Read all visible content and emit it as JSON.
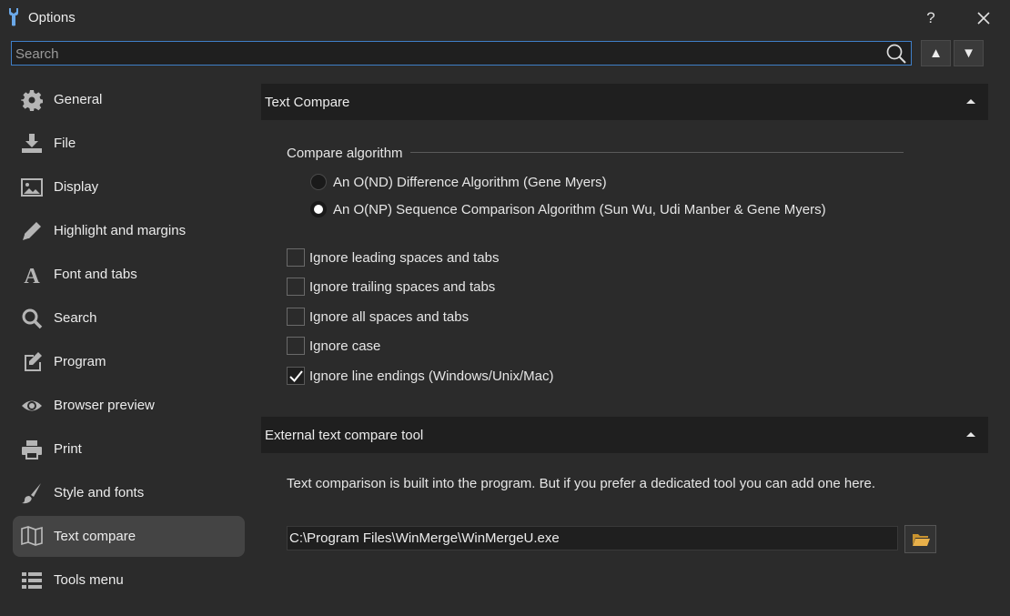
{
  "window": {
    "title": "Options",
    "help_label": "?"
  },
  "search": {
    "placeholder": "Search",
    "up_label": "▲",
    "down_label": "▼"
  },
  "sidebar": {
    "items": [
      {
        "label": "General",
        "icon": "gear-icon"
      },
      {
        "label": "File",
        "icon": "download-icon"
      },
      {
        "label": "Display",
        "icon": "image-icon"
      },
      {
        "label": "Highlight and margins",
        "icon": "pencil-icon"
      },
      {
        "label": "Font and tabs",
        "icon": "font-icon"
      },
      {
        "label": "Search",
        "icon": "search-icon"
      },
      {
        "label": "Program",
        "icon": "edit-icon"
      },
      {
        "label": "Browser preview",
        "icon": "eye-icon"
      },
      {
        "label": "Print",
        "icon": "printer-icon"
      },
      {
        "label": "Style and fonts",
        "icon": "brush-icon"
      },
      {
        "label": "Text compare",
        "icon": "map-icon",
        "active": true
      },
      {
        "label": "Tools menu",
        "icon": "list-icon"
      }
    ]
  },
  "text_compare": {
    "title": "Text Compare",
    "algorithm_label": "Compare algorithm",
    "algorithms": [
      {
        "label": "An O(ND) Difference Algorithm (Gene Myers)",
        "selected": false
      },
      {
        "label": "An O(NP) Sequence Comparison Algorithm (Sun Wu, Udi Manber & Gene Myers)",
        "selected": true
      }
    ],
    "options": [
      {
        "label": "Ignore leading spaces and tabs",
        "checked": false
      },
      {
        "label": "Ignore trailing spaces and tabs",
        "checked": false
      },
      {
        "label": "Ignore all spaces and tabs",
        "checked": false
      },
      {
        "label": "Ignore case",
        "checked": false
      },
      {
        "label": "Ignore line endings (Windows/Unix/Mac)",
        "checked": true
      }
    ]
  },
  "external_tool": {
    "title": "External text compare tool",
    "description": "Text comparison is built into the program. But if you prefer a dedicated tool you can add one here.",
    "path_value": "C:\\Program Files\\WinMerge\\WinMergeU.exe"
  },
  "colors": {
    "accent": "#3f7fc8",
    "background": "#2b2b2b",
    "header_bg": "#1f1f1f",
    "active_item": "#444444",
    "folder": "#e8b04a"
  }
}
